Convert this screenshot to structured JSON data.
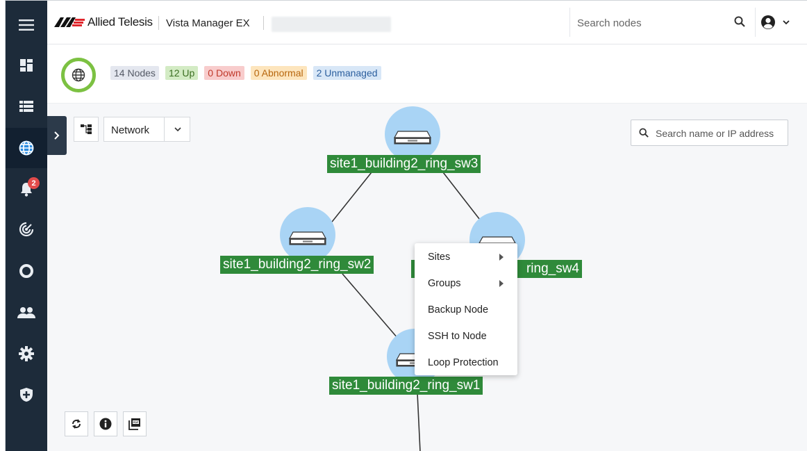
{
  "header": {
    "brand": "Allied Telesis",
    "product": "Vista Manager EX",
    "search_placeholder": "Search nodes"
  },
  "status": {
    "nodes": "14 Nodes",
    "up": "12 Up",
    "down": "0 Down",
    "abnormal": "0 Abnormal",
    "unmanaged": "2 Unmanaged"
  },
  "sidebar": {
    "items": [
      {
        "icon": "menu-icon"
      },
      {
        "icon": "dashboard-icon"
      },
      {
        "icon": "list-icon"
      },
      {
        "icon": "globe-icon",
        "active": true
      },
      {
        "icon": "bell-icon",
        "badge": "2"
      },
      {
        "icon": "radar-icon"
      },
      {
        "icon": "cloud-icon"
      },
      {
        "icon": "users-icon"
      },
      {
        "icon": "gear-icon"
      },
      {
        "icon": "shield-icon"
      }
    ]
  },
  "toolbar": {
    "view_label": "Network",
    "node_search_placeholder": "Search name or IP address"
  },
  "topology": {
    "nodes": [
      {
        "label": "site1_building2_ring_sw3"
      },
      {
        "label": "site1_building2_ring_sw2"
      },
      {
        "label": "site1_building2_ring_sw4",
        "visible_label": "ring_sw4"
      },
      {
        "label": "site1_building2_ring_sw1"
      }
    ]
  },
  "context_menu": {
    "items": [
      {
        "label": "Sites",
        "submenu": true
      },
      {
        "label": "Groups",
        "submenu": true
      },
      {
        "label": "Backup Node",
        "submenu": false
      },
      {
        "label": "SSH to Node",
        "submenu": false
      },
      {
        "label": "Loop Protection",
        "submenu": false
      }
    ]
  },
  "colors": {
    "sidebar_bg": "#1d2b3a",
    "node_label_bg": "#2f8a3a",
    "halo": "#a9d4f5",
    "status_ring": "#7cc142"
  }
}
